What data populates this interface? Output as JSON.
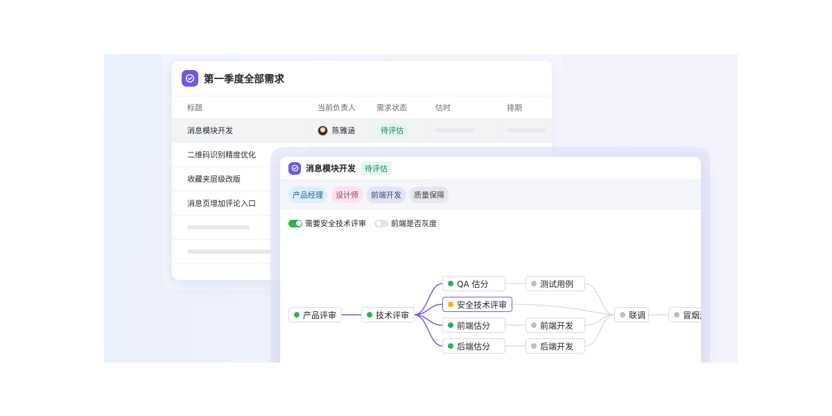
{
  "colors": {
    "accent": "#6a5ae6",
    "status_green": "#14835c",
    "done_dot": "#2eb24f",
    "warn_dot": "#f5b50b"
  },
  "back_card": {
    "title": "第一季度全部需求",
    "columns": [
      "标题",
      "当前负责人",
      "需求状态",
      "估时",
      "排期"
    ],
    "rows": [
      {
        "title": "消息模块开发",
        "owner": "陈雅涵",
        "status": "待评估"
      },
      {
        "title": "二维码识别精度优化"
      },
      {
        "title": "收藏夹层级改版"
      },
      {
        "title": "消息页增加评论入口"
      }
    ]
  },
  "front_card": {
    "title": "消息模块开发",
    "status": "待评估",
    "roles": [
      {
        "label": "产品经理",
        "bg": "#dceefb",
        "fg": "#2a5f86"
      },
      {
        "label": "设计师",
        "bg": "#fbe2ef",
        "fg": "#8e3a66"
      },
      {
        "label": "前端开发",
        "bg": "#e2e4f7",
        "fg": "#3e4470"
      },
      {
        "label": "质量保障",
        "bg": "#e6e7ea",
        "fg": "#44474f"
      }
    ],
    "toggles": [
      {
        "label": "需要安全技术评审",
        "on": true
      },
      {
        "label": "前端是否灰度",
        "on": false
      }
    ],
    "flow": {
      "product_review": "产品评审",
      "tech_review": "技术评审",
      "qa_estimate": "QA 估分",
      "security_review": "安全技术评审",
      "frontend_estimate": "前端估分",
      "backend_estimate": "后端估分",
      "test_cases": "测试用例",
      "frontend_dev": "前端开发",
      "backend_dev": "后端开发",
      "integration": "联调",
      "smoke_test": "冒烟测试"
    }
  }
}
